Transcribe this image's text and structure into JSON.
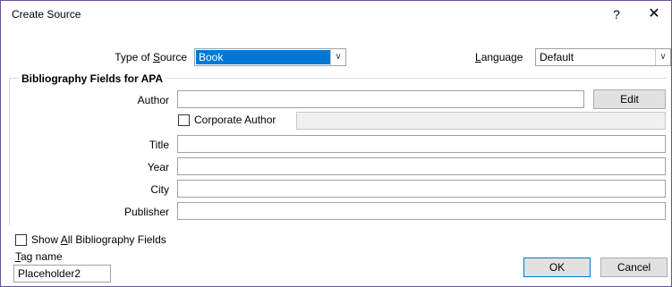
{
  "window": {
    "title": "Create Source",
    "help_glyph": "?",
    "close_glyph": "✕"
  },
  "type_of_source": {
    "label_pre": "Type of ",
    "label_ul": "S",
    "label_post": "ource",
    "value": "Book"
  },
  "language": {
    "label_ul": "L",
    "label_post": "anguage",
    "value": "Default"
  },
  "group": {
    "title": "Bibliography Fields for APA"
  },
  "fields": {
    "author": {
      "label": "Author",
      "value": ""
    },
    "edit_button": "Edit",
    "corporate_author": {
      "label": "Corporate Author",
      "checked": false
    },
    "title": {
      "label": "Title",
      "value": ""
    },
    "year": {
      "label": "Year",
      "value": ""
    },
    "city": {
      "label": "City",
      "value": ""
    },
    "publisher": {
      "label": "Publisher",
      "value": ""
    }
  },
  "show_all": {
    "label_pre": "Show ",
    "label_ul": "A",
    "label_post": "ll Bibliography Fields",
    "checked": false
  },
  "tag": {
    "label_ul": "T",
    "label_post": "ag name",
    "value": "Placeholder2"
  },
  "buttons": {
    "ok": "OK",
    "cancel": "Cancel"
  },
  "icons": {
    "dropdown": "chevron-down-icon",
    "help": "help-icon",
    "close": "close-icon"
  },
  "colors": {
    "accent": "#0078d7",
    "border": "#6b4fa0"
  }
}
